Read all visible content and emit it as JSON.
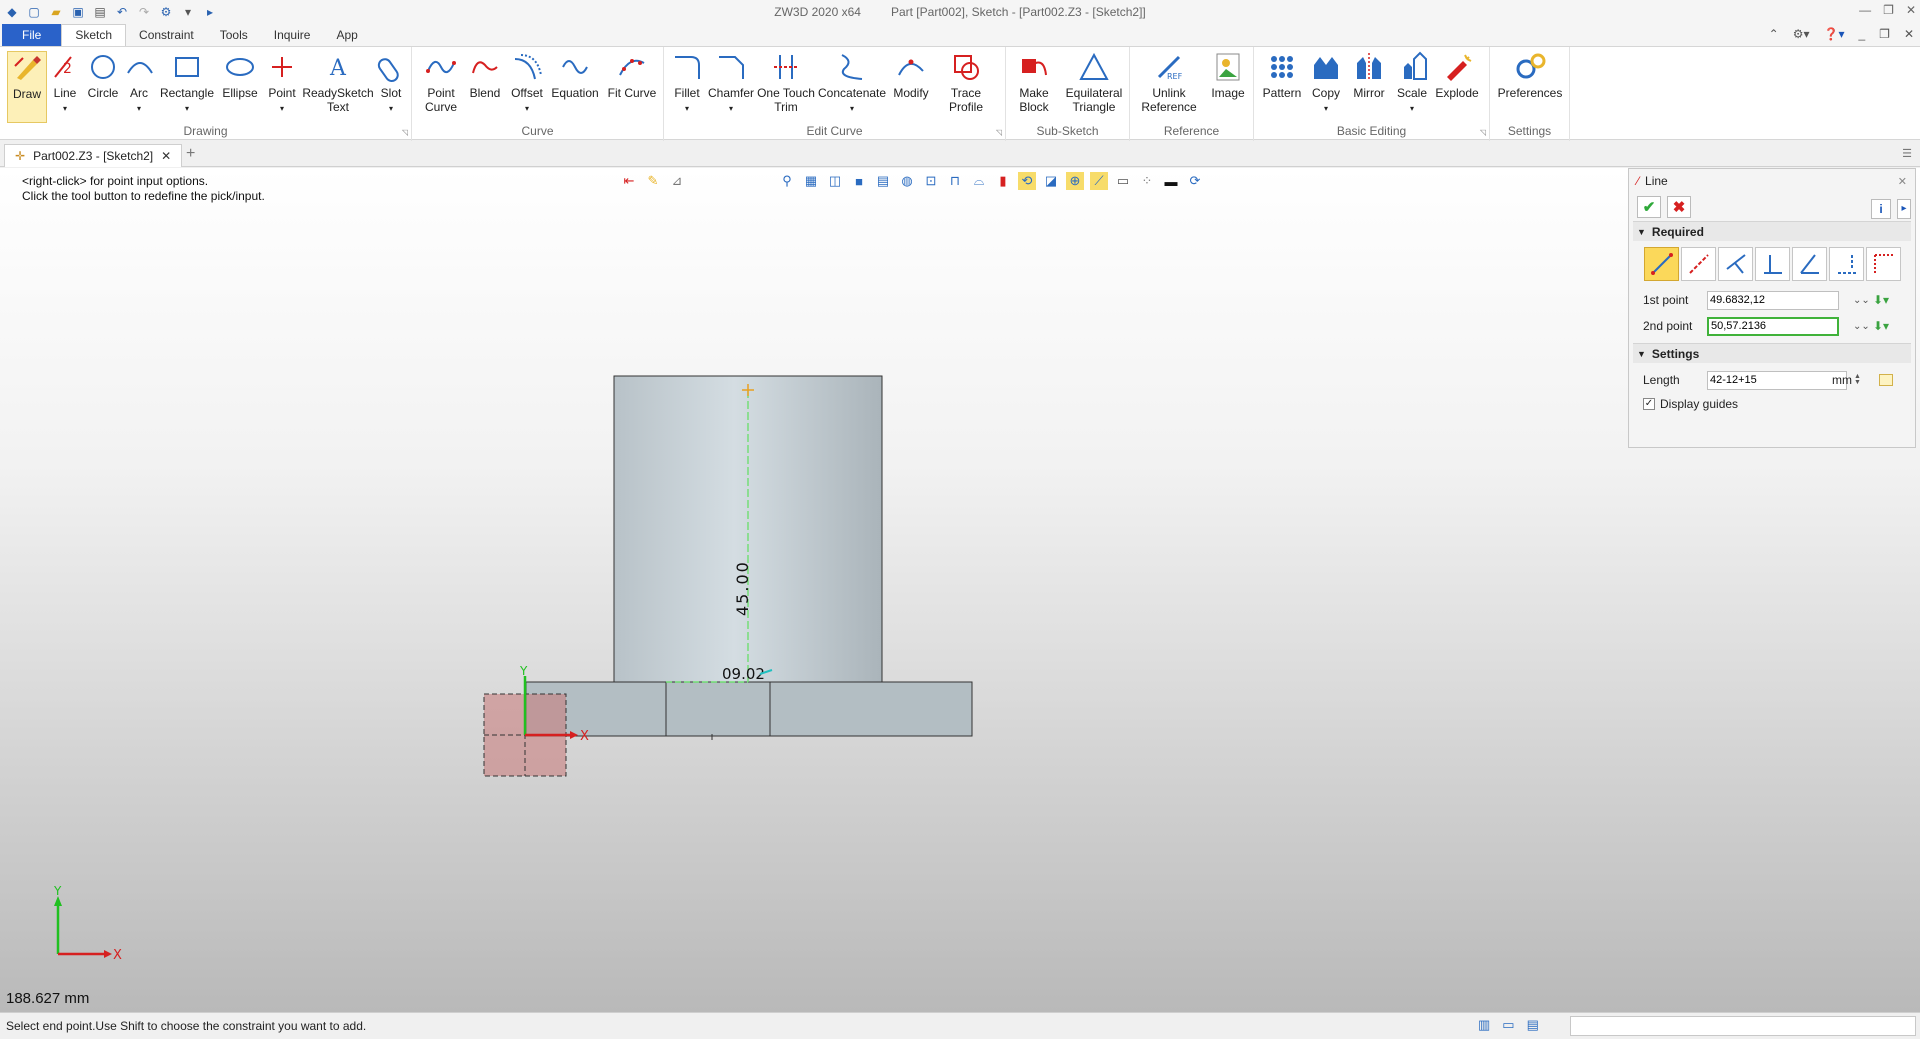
{
  "titlebar": {
    "app_title": "ZW3D 2020 x64",
    "doc_title": "Part [Part002],  Sketch - [Part002.Z3 - [Sketch2]]"
  },
  "menubar": {
    "tabs": [
      "File",
      "Sketch",
      "Constraint",
      "Tools",
      "Inquire",
      "App"
    ],
    "active": "Sketch"
  },
  "ribbon": {
    "drawing": {
      "label": "Drawing",
      "buttons": [
        "Draw",
        "Line",
        "Circle",
        "Arc",
        "Rectangle",
        "Ellipse",
        "Point",
        "ReadySketch Text",
        "Slot"
      ]
    },
    "curve": {
      "label": "Curve",
      "buttons": [
        "Point Curve",
        "Blend",
        "Offset",
        "Equation",
        "Fit Curve"
      ]
    },
    "edit_curve": {
      "label": "Edit Curve",
      "buttons": [
        "Fillet",
        "Chamfer",
        "One Touch Trim",
        "Concatenate",
        "Modify",
        "Trace Profile"
      ]
    },
    "sub_sketch": {
      "label": "Sub-Sketch",
      "buttons": [
        "Make Block",
        "Equilateral Triangle"
      ]
    },
    "reference": {
      "label": "Reference",
      "buttons": [
        "Unlink Reference",
        "Image"
      ]
    },
    "basic_editing": {
      "label": "Basic Editing",
      "buttons": [
        "Pattern",
        "Copy",
        "Mirror",
        "Scale",
        "Explode"
      ]
    },
    "settings": {
      "label": "Settings",
      "buttons": [
        "Preferences"
      ]
    }
  },
  "doc_tab": {
    "label": "Part002.Z3 - [Sketch2]"
  },
  "viewport": {
    "hint_line1": "<right-click> for point input options.",
    "hint_line2": "Click the tool button to redefine the pick/input.",
    "dimension_label": "45.00",
    "small_dim_label": "09.02",
    "axis_x": "X",
    "axis_y": "Y",
    "readout": "188.627 mm"
  },
  "line_panel": {
    "title": "Line",
    "required_label": "Required",
    "first_point_label": "1st point",
    "first_point_value": "49.6832,12",
    "second_point_label": "2nd point",
    "second_point_value": "50,57.2136",
    "settings_label": "Settings",
    "length_label": "Length",
    "length_value": "42-12+15",
    "length_unit": "mm",
    "display_guides_label": "Display guides",
    "display_guides_checked": true
  },
  "statusbar": {
    "message": "Select end point.Use Shift to choose the constraint you want to add."
  },
  "colors": {
    "accent": "#2a62c9",
    "highlight": "#fbd85a",
    "confirm": "#2fa93a",
    "cancel": "#d62020"
  }
}
